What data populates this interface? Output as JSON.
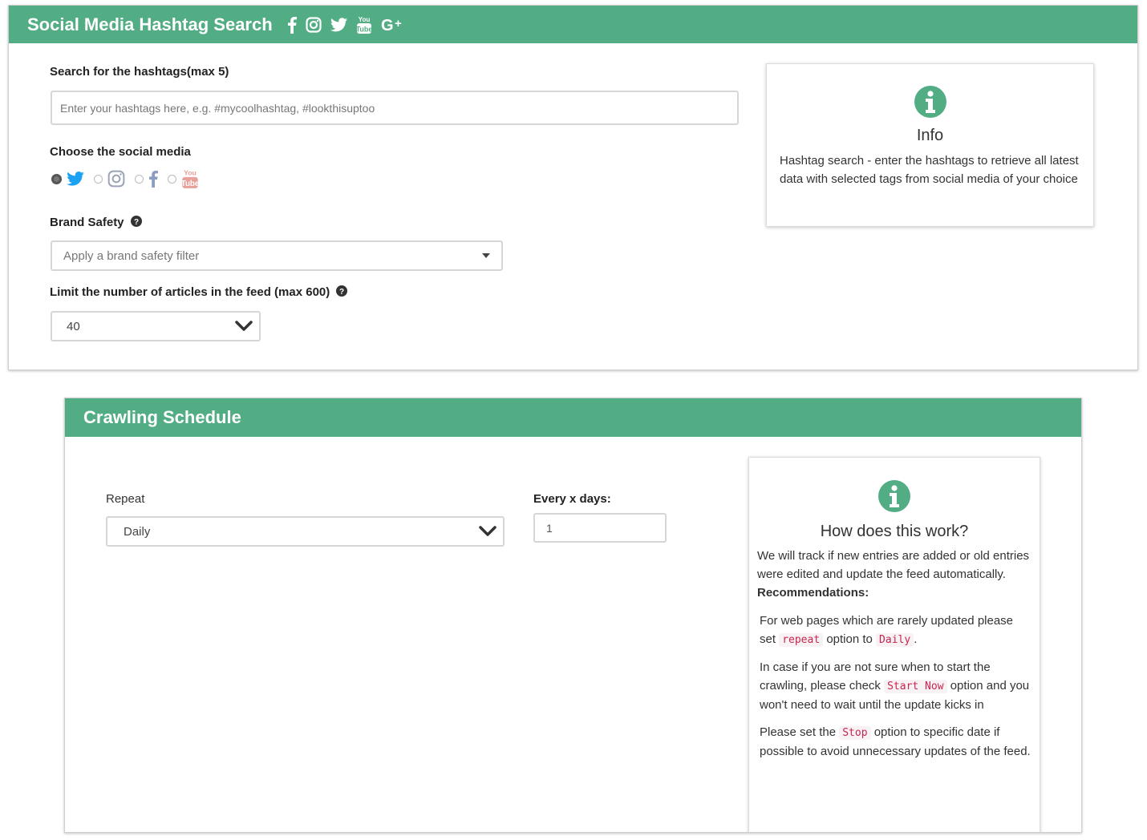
{
  "hashtag_panel": {
    "title": "Social Media Hashtag Search",
    "header_icons": [
      "facebook-icon",
      "instagram-icon",
      "twitter-icon",
      "youtube-icon",
      "google-plus-icon"
    ],
    "search_label": "Search for the hashtags(max 5)",
    "search_placeholder": "Enter your hashtags here, e.g. #mycoolhashtag, #lookthisuptoo",
    "social_label": "Choose the social media",
    "social_options": [
      {
        "icon": "twitter-icon",
        "selected": true
      },
      {
        "icon": "instagram-icon",
        "selected": false
      },
      {
        "icon": "facebook-icon",
        "selected": false
      },
      {
        "icon": "youtube-icon",
        "selected": false
      }
    ],
    "brand_safety_label": "Brand Safety",
    "brand_safety_placeholder": "Apply a brand safety filter",
    "limit_label": "Limit the number of articles in the feed (max 600)",
    "limit_value": "40",
    "info": {
      "title": "Info",
      "text": "Hashtag search - enter the hashtags to retrieve all latest data with selected tags from social media of your choice"
    }
  },
  "schedule_panel": {
    "title": "Crawling Schedule",
    "repeat_label": "Repeat",
    "repeat_value": "Daily",
    "every_label": "Every x days:",
    "every_value": "1",
    "info": {
      "title": "How does this work?",
      "intro": "We will track if new entries are added or old entries were edited and update the feed automatically.",
      "recommendations_label": "Recommendations:",
      "rec1_a": "For web pages which are rarely updated please set",
      "rec1_code1": "repeat",
      "rec1_b": "option to",
      "rec1_code2": "Daily",
      "rec1_c": ".",
      "rec2_a": "In case if you are not sure when to start the crawling, please check",
      "rec2_code": "Start Now",
      "rec2_b": "option and you won't need to wait until the update kicks in",
      "rec3_a": "Please set the",
      "rec3_code": "Stop",
      "rec3_b": "option to specific date if possible to avoid unnecessary updates of the feed."
    }
  },
  "colors": {
    "header_green": "#52ad84",
    "twitter_blue": "#1da1f2",
    "instagram_gray": "#9aa3b5",
    "facebook_gray": "#8b9dc3",
    "youtube_red": "#e8a09a",
    "code_red": "#c7254e"
  }
}
